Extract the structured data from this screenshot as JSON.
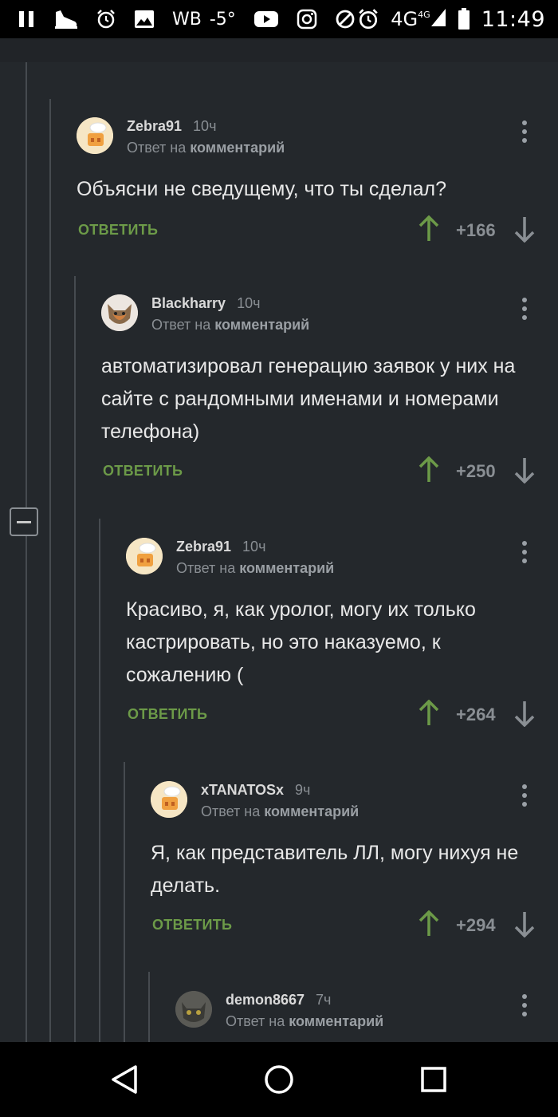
{
  "status_bar": {
    "icons": [
      "pause-icon",
      "shoe-icon",
      "alarm-icon",
      "image-icon",
      "wb-text",
      "temperature",
      "youtube-icon",
      "instagram-icon",
      "block-icon",
      "alarm-icon",
      "network-4g",
      "signal-icon",
      "battery-icon"
    ],
    "wb": "WB",
    "temperature": "-5°",
    "network": "4G",
    "network_small": "4G",
    "time": "11:49"
  },
  "comments": [
    {
      "author": "Zebra91",
      "time": "10ч",
      "reply_prefix": "Ответ на",
      "reply_link": "комментарий",
      "text": "Объясни не сведущему, что ты сделал?",
      "reply_label": "ОТВЕТИТЬ",
      "score": "+166",
      "avatar": "chef-avatar"
    },
    {
      "author": "Blackharry",
      "time": "10ч",
      "reply_prefix": "Ответ на",
      "reply_link": "комментарий",
      "text": "автоматизировал генерацию заявок у них на сайте с рандомными именами и номерами телефона)",
      "reply_label": "ОТВЕТИТЬ",
      "score": "+250",
      "avatar": "fox-avatar"
    },
    {
      "author": "Zebra91",
      "time": "10ч",
      "reply_prefix": "Ответ на",
      "reply_link": "комментарий",
      "text": "Красиво, я, как уролог, могу их только кастрировать, но это наказуемо, к сожалению (",
      "reply_label": "ОТВЕТИТЬ",
      "score": "+264",
      "avatar": "chef-avatar"
    },
    {
      "author": "xTANATOSx",
      "time": "9ч",
      "reply_prefix": "Ответ на",
      "reply_link": "комментарий",
      "text": "Я, как представитель ЛЛ, могу нихуя не делать.",
      "reply_label": "ОТВЕТИТЬ",
      "score": "+294",
      "avatar": "chef-avatar"
    },
    {
      "author": "demon8667",
      "time": "7ч",
      "reply_prefix": "Ответ на",
      "reply_link": "комментарий",
      "avatar": "cat-avatar"
    }
  ],
  "colors": {
    "background": "#24282c",
    "reply_green": "#6c9a48",
    "upvote_green": "#6c9a48",
    "muted": "#8a8f94"
  },
  "nav_bar": {
    "buttons": [
      "back-icon",
      "home-icon",
      "recents-icon"
    ]
  }
}
